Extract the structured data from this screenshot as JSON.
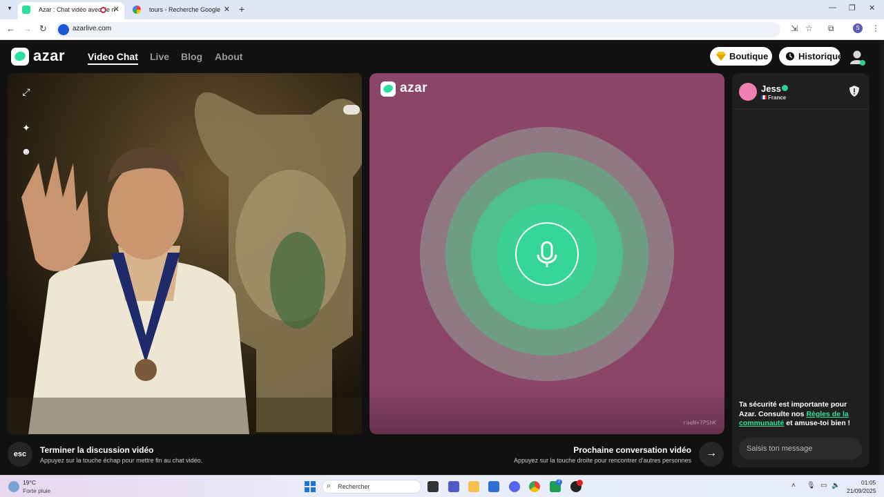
{
  "browser": {
    "tabs": [
      {
        "title": "Azar : Chat vidéo avec de n",
        "active": true
      },
      {
        "title": "tours - Recherche Google",
        "active": false
      }
    ],
    "new_tab_glyph": "+",
    "url": "azarlive.com",
    "profile_initial": "S"
  },
  "header": {
    "logo_text": "azar",
    "nav": [
      {
        "label": "Video Chat",
        "active": true
      },
      {
        "label": "Live",
        "active": false
      },
      {
        "label": "Blog",
        "active": false
      },
      {
        "label": "About",
        "active": false
      }
    ],
    "shop_label": "Boutique",
    "history_label": "Historique"
  },
  "partner": {
    "logo_text": "azar",
    "watermark": "raeN+7PShK",
    "bg_color": "#8a4568",
    "accent": "#34d597"
  },
  "chat": {
    "name": "Jess",
    "country": "France",
    "safety_text_1": "Ta sécurité est importante pour Azar. Consulte nos ",
    "safety_link": "Règles de la communauté",
    "safety_text_2": " et amuse-toi bien !",
    "input_placeholder": "Saisis ton message"
  },
  "actions": {
    "end_key": "esc",
    "end_title": "Terminer la discussion vidéo",
    "end_sub": "Appuyez sur la touche échap pour mettre fin au chat vidéo.",
    "next_title": "Prochaine conversation vidéo",
    "next_sub": "Appuyez sur la touche droite pour rencontrer d'autres personnes",
    "next_glyph": "→"
  },
  "taskbar": {
    "temp": "19°C",
    "weather": "Forte pluie",
    "search_placeholder": "Rechercher",
    "teams_badge": "2",
    "time": "01:05",
    "date": "21/09/2025"
  }
}
